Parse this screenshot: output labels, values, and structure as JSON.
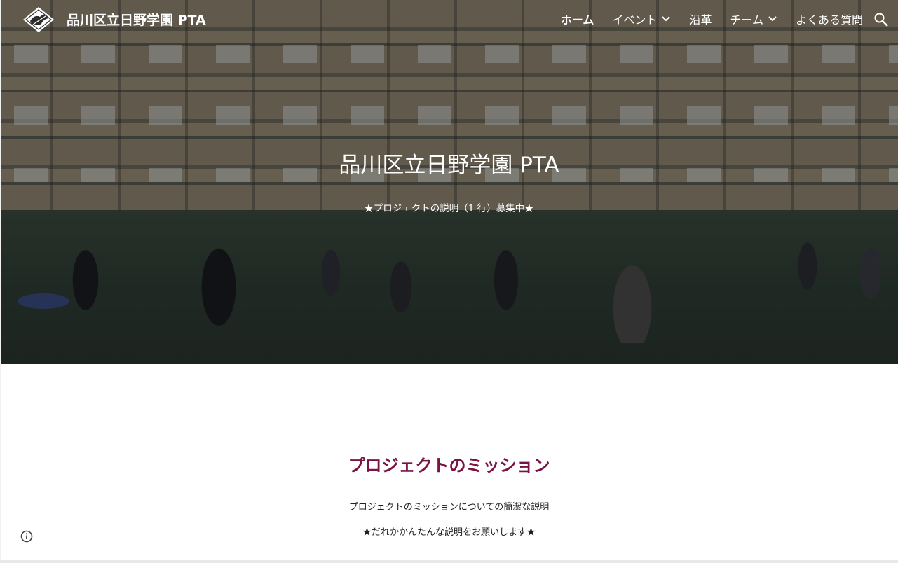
{
  "header": {
    "site_title": "品川区立日野学園 PTA",
    "logo_icon": "school-emblem-icon"
  },
  "nav": {
    "items": [
      {
        "label": "ホーム",
        "active": true
      },
      {
        "label": "イベント",
        "dropdown": true
      },
      {
        "label": "沿革"
      },
      {
        "label": "チーム",
        "dropdown": true
      },
      {
        "label": "よくある質問"
      }
    ],
    "search_icon": "search-icon"
  },
  "hero": {
    "title": "品川区立日野学園 PTA",
    "subtitle": "★プロジェクトの説明（1 行）募集中★"
  },
  "mission": {
    "heading": "プロジェクトのミッション",
    "text": "プロジェクトのミッションについての簡潔な説明",
    "note": "★だれかかんたんな説明をお願いします★"
  },
  "footer": {
    "info_icon": "info-icon"
  },
  "colors": {
    "accent": "#7b1245",
    "text": "#212121",
    "nav_text": "#ffffff"
  }
}
